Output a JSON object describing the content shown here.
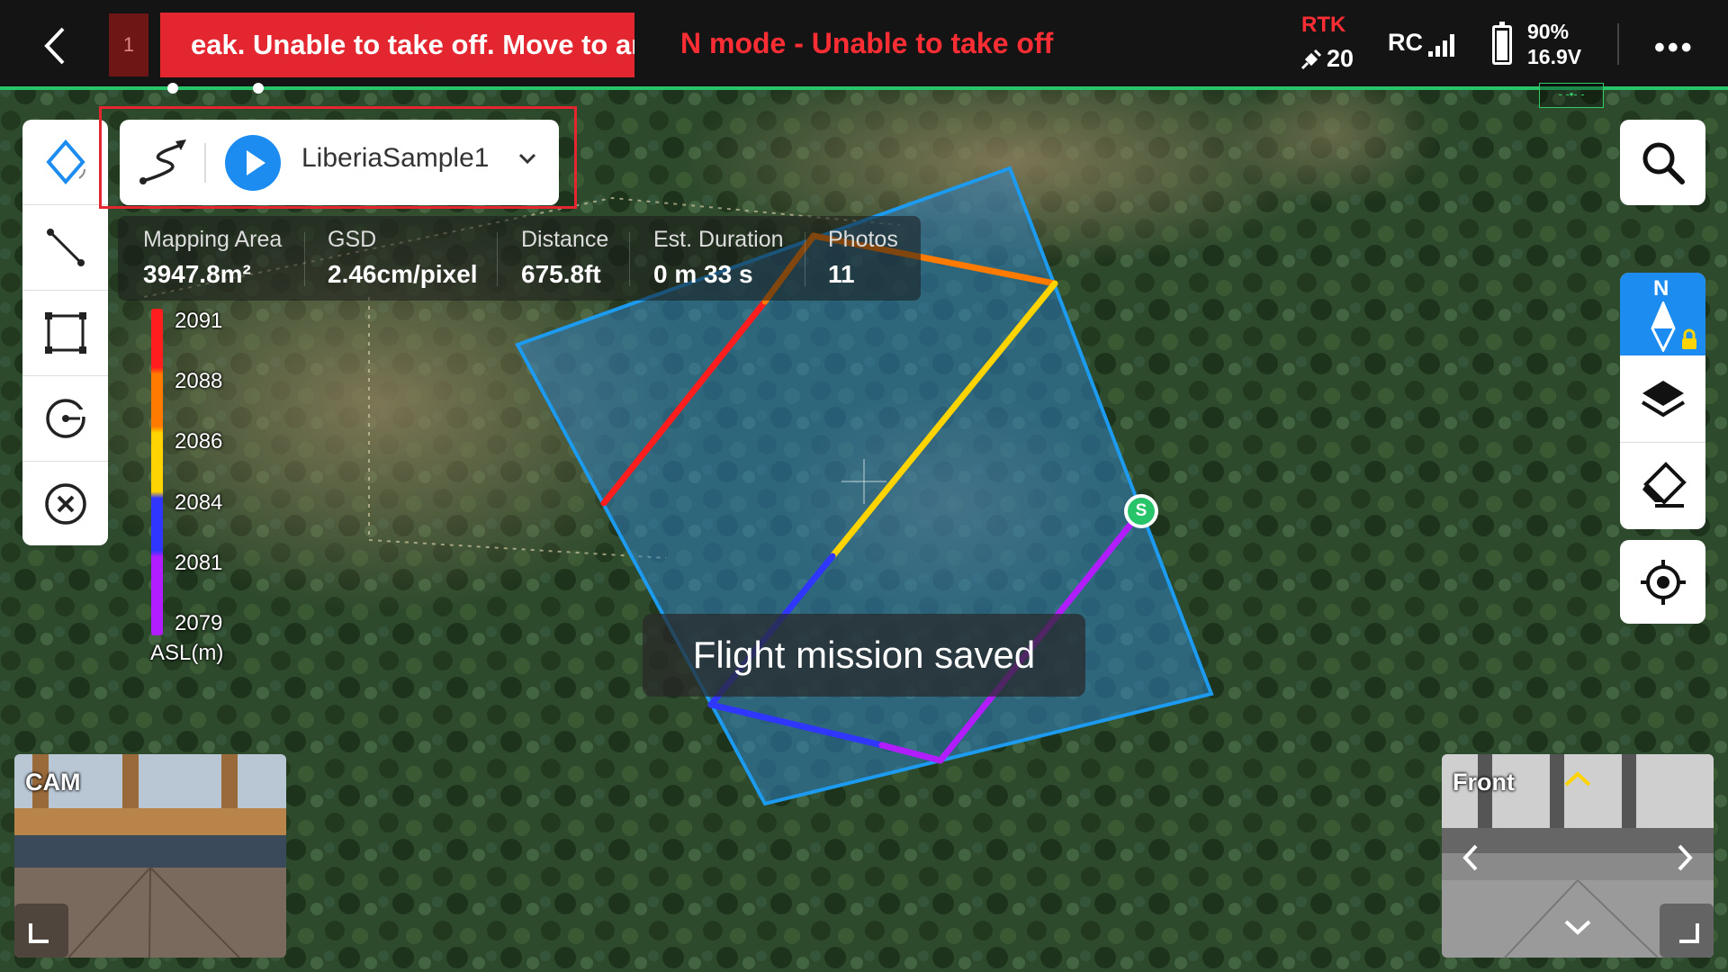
{
  "status_bar": {
    "alert_count": "1",
    "alert_banner": "eak. Unable to take off. Move to ar",
    "mode_alert": "N mode - Unable to take off",
    "rtk_label": "RTK",
    "satellite_count": "20",
    "rc_label": "RC",
    "battery_percent": "90%",
    "battery_voltage": "16.9V",
    "more_label": "•••"
  },
  "mission": {
    "name": "LiberiaSample1"
  },
  "stats": [
    {
      "label": "Mapping Area",
      "value": "3947.8m²"
    },
    {
      "label": "GSD",
      "value": "2.46cm/pixel"
    },
    {
      "label": "Distance",
      "value": "675.8ft"
    },
    {
      "label": "Est. Duration",
      "value": "0 m 33 s"
    },
    {
      "label": "Photos",
      "value": "11"
    }
  ],
  "altitude_legend": {
    "ticks": [
      "2091",
      "2088",
      "2086",
      "2084",
      "2081",
      "2079"
    ],
    "unit": "ASL(m)",
    "colors": [
      "#ff1d1d",
      "#ff7a00",
      "#ffd400",
      "#2f36ff",
      "#b21dff"
    ]
  },
  "toast": {
    "message": "Flight mission saved"
  },
  "map": {
    "start_marker_label": "S",
    "compass_label": "N",
    "area_fill": "#2f7fc0",
    "area_stroke": "#1c9bf0"
  },
  "pip": {
    "cam_label": "CAM",
    "front_label": "Front"
  },
  "colors": {
    "accent": "#1c8cf0",
    "alert": "#e3262f",
    "status_line": "#27c46a"
  }
}
